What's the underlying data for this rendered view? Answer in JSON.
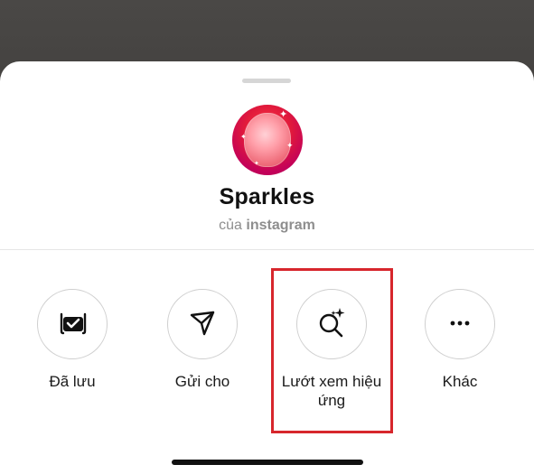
{
  "effect": {
    "name": "Sparkles",
    "byline_prefix": "của",
    "author": "instagram"
  },
  "actions": [
    {
      "label": "Đã lưu",
      "icon": "saved-effect-icon"
    },
    {
      "label": "Gửi cho",
      "icon": "send-icon"
    },
    {
      "label": "Lướt xem hiệu ứng",
      "icon": "browse-effects-icon"
    },
    {
      "label": "Khác",
      "icon": "more-icon"
    }
  ],
  "colors": {
    "highlight": "#d7262c",
    "sheet": "#ffffff",
    "icon_stroke": "#111111"
  }
}
